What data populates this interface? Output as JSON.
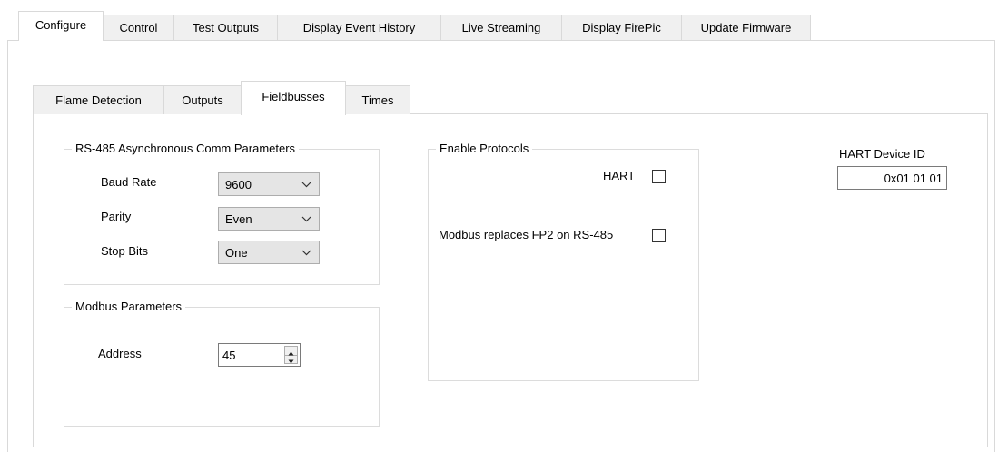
{
  "top_tabs": [
    {
      "label": "Configure",
      "active": true
    },
    {
      "label": "Control"
    },
    {
      "label": "Test Outputs"
    },
    {
      "label": "Display Event History"
    },
    {
      "label": "Live Streaming"
    },
    {
      "label": "Display FirePic"
    },
    {
      "label": "Update Firmware"
    }
  ],
  "sub_tabs": [
    {
      "label": "Flame Detection"
    },
    {
      "label": "Outputs"
    },
    {
      "label": "Fieldbusses",
      "active": true
    },
    {
      "label": "Times"
    }
  ],
  "rs485": {
    "title": "RS-485 Asynchronous Comm Parameters",
    "baud_rate": {
      "label": "Baud Rate",
      "value": "9600"
    },
    "parity": {
      "label": "Parity",
      "value": "Even"
    },
    "stop_bits": {
      "label": "Stop Bits",
      "value": "One"
    }
  },
  "modbus": {
    "title": "Modbus Parameters",
    "address_label": "Address",
    "address_value": "45"
  },
  "protocols": {
    "title": "Enable Protocols",
    "hart_label": "HART",
    "hart_checked": false,
    "modbus_fp2_label": "Modbus replaces FP2 on RS-485",
    "modbus_fp2_checked": false
  },
  "hart_device": {
    "label": "HART Device ID",
    "value": "0x01 01 01"
  },
  "icons": {
    "combo_arrow": "chevron-down-icon",
    "spin_up": "triangle-up-icon",
    "spin_down": "triangle-down-icon"
  },
  "colors": {
    "tab_inactive_bg": "#f0f0f0",
    "border": "#d9d9d9",
    "combo_bg": "#e5e5e5"
  }
}
